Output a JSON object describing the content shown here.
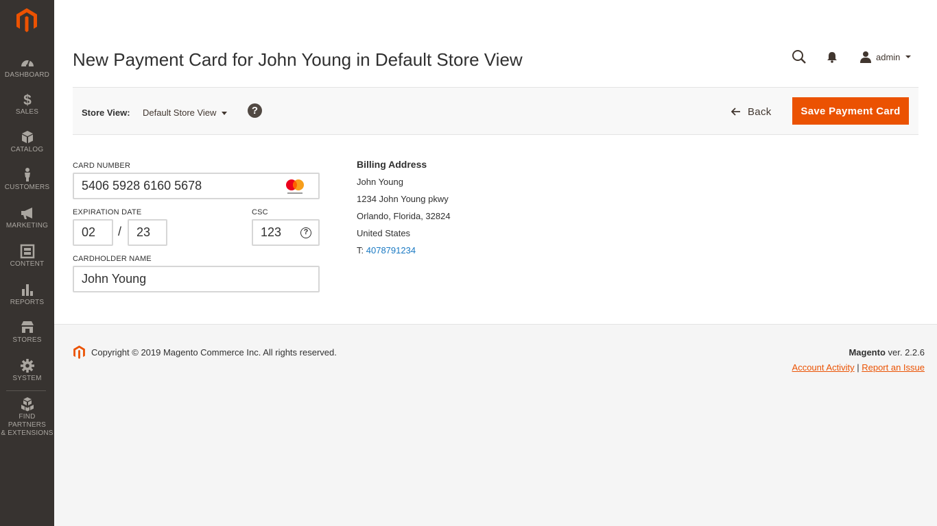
{
  "sidebar": {
    "logo": "magento-logo",
    "items": [
      {
        "label": "DASHBOARD",
        "icon": "dashboard-icon"
      },
      {
        "label": "SALES",
        "icon": "dollar-icon"
      },
      {
        "label": "CATALOG",
        "icon": "box-icon"
      },
      {
        "label": "CUSTOMERS",
        "icon": "person-icon"
      },
      {
        "label": "MARKETING",
        "icon": "megaphone-icon"
      },
      {
        "label": "CONTENT",
        "icon": "layout-icon"
      },
      {
        "label": "REPORTS",
        "icon": "bar-chart-icon"
      },
      {
        "label": "STORES",
        "icon": "storefront-icon"
      },
      {
        "label": "SYSTEM",
        "icon": "gear-icon"
      },
      {
        "label": "FIND PARTNERS",
        "label2": "& EXTENSIONS",
        "icon": "cubes-icon"
      }
    ]
  },
  "header": {
    "title": "New Payment Card for John Young in Default Store View",
    "admin_label": "admin"
  },
  "toolbar": {
    "store_view_label": "Store View:",
    "store_view_value": "Default Store View",
    "help_symbol": "?",
    "back_label": "Back",
    "save_label": "Save Payment Card"
  },
  "form": {
    "card_number_label": "CARD NUMBER",
    "card_number": "5406 5928 6160 5678",
    "card_brand": "mastercard",
    "expiration_label": "EXPIRATION DATE",
    "exp_month": "02",
    "exp_separator": "/",
    "exp_year": "23",
    "csc_label": "CSC",
    "csc": "123",
    "csc_help_symbol": "?",
    "cardholder_label": "CARDHOLDER NAME",
    "cardholder": "John Young"
  },
  "billing": {
    "title": "Billing Address",
    "name": "John Young",
    "street": "1234 John Young pkwy",
    "city_line": "Orlando, Florida, 32824",
    "country": "United States",
    "phone_prefix": "T:",
    "phone": "4078791234"
  },
  "footer": {
    "copyright": "Copyright © 2019 Magento Commerce Inc. All rights reserved.",
    "brand": "Magento",
    "version": "ver. 2.2.6",
    "account_activity": "Account Activity",
    "separator": "|",
    "report_issue": "Report an Issue"
  },
  "colors": {
    "sidebar_bg": "#373330",
    "accent": "#eb5202",
    "link": "#1979c3"
  }
}
